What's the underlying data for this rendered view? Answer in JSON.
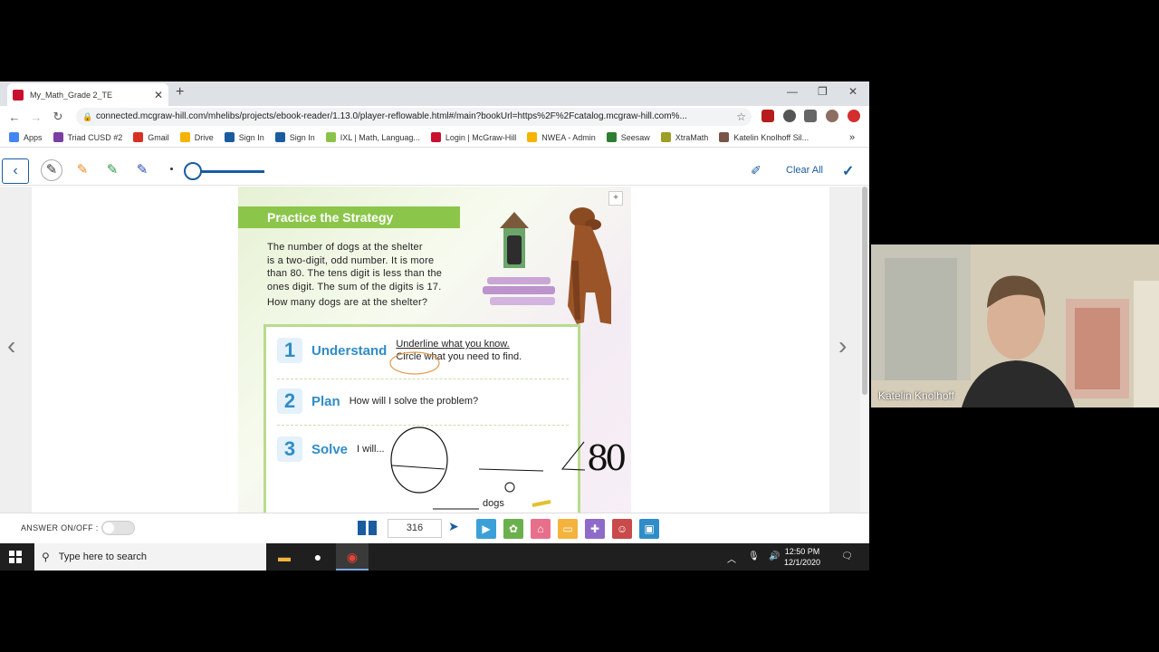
{
  "browser": {
    "tab_title": "My_Math_Grade 2_TE",
    "url": "connected.mcgraw-hill.com/mhelibs/projects/ebook-reader/1.13.0/player-reflowable.html#/main?bookUrl=https%2F%2Fcatalog.mcgraw-hill.com%...",
    "bookmarks": [
      {
        "label": "Apps",
        "color": "#4285f4"
      },
      {
        "label": "Triad CUSD #2",
        "color": "#7b3fa0"
      },
      {
        "label": "Gmail",
        "color": "#d93025"
      },
      {
        "label": "Drive",
        "color": "#f4b400"
      },
      {
        "label": "Sign In",
        "color": "#1a5c9e"
      },
      {
        "label": "Sign In",
        "color": "#1a5c9e"
      },
      {
        "label": "IXL | Math, Languag...",
        "color": "#8bc34a"
      },
      {
        "label": "Login | McGraw-Hill",
        "color": "#c8102e"
      },
      {
        "label": "NWEA - Admin",
        "color": "#f4b400"
      },
      {
        "label": "Seesaw",
        "color": "#2e7d32"
      },
      {
        "label": "XtraMath",
        "color": "#9e9d24"
      },
      {
        "label": "Katelin Knolhoff Sil...",
        "color": "#795548"
      }
    ],
    "more": "»"
  },
  "reader": {
    "clear_all": "Clear All",
    "page_number": "316",
    "answer_toggle_label": "ANSWER ON/OFF :",
    "pen_colors": [
      "#333333",
      "#f08a24",
      "#2e9a44",
      "#2a4fb5"
    ],
    "accent": "#1a5c9e"
  },
  "page": {
    "heading": "Practice the Strategy",
    "problem_lines": [
      "The number of dogs at the shelter",
      "is a two-digit, odd number. It is more",
      "than 80. The tens digit is less than the",
      "ones digit. The sum of the digits is 17."
    ],
    "question": "How many dogs are at the shelter?",
    "steps": [
      {
        "num": "1",
        "name": "Understand",
        "desc1": "Underline what you know.",
        "desc2": "Circle what you need to find."
      },
      {
        "num": "2",
        "name": "Plan",
        "desc1": "How will I solve the problem?"
      },
      {
        "num": "3",
        "name": "Solve",
        "desc1": "I will..."
      }
    ],
    "answer_unit": "dogs",
    "handwriting": "80"
  },
  "taskbar": {
    "search_placeholder": "Type here to search",
    "time": "12:50 PM",
    "date": "12/1/2020"
  },
  "webcam": {
    "name": "Katelin Knolhoff"
  }
}
